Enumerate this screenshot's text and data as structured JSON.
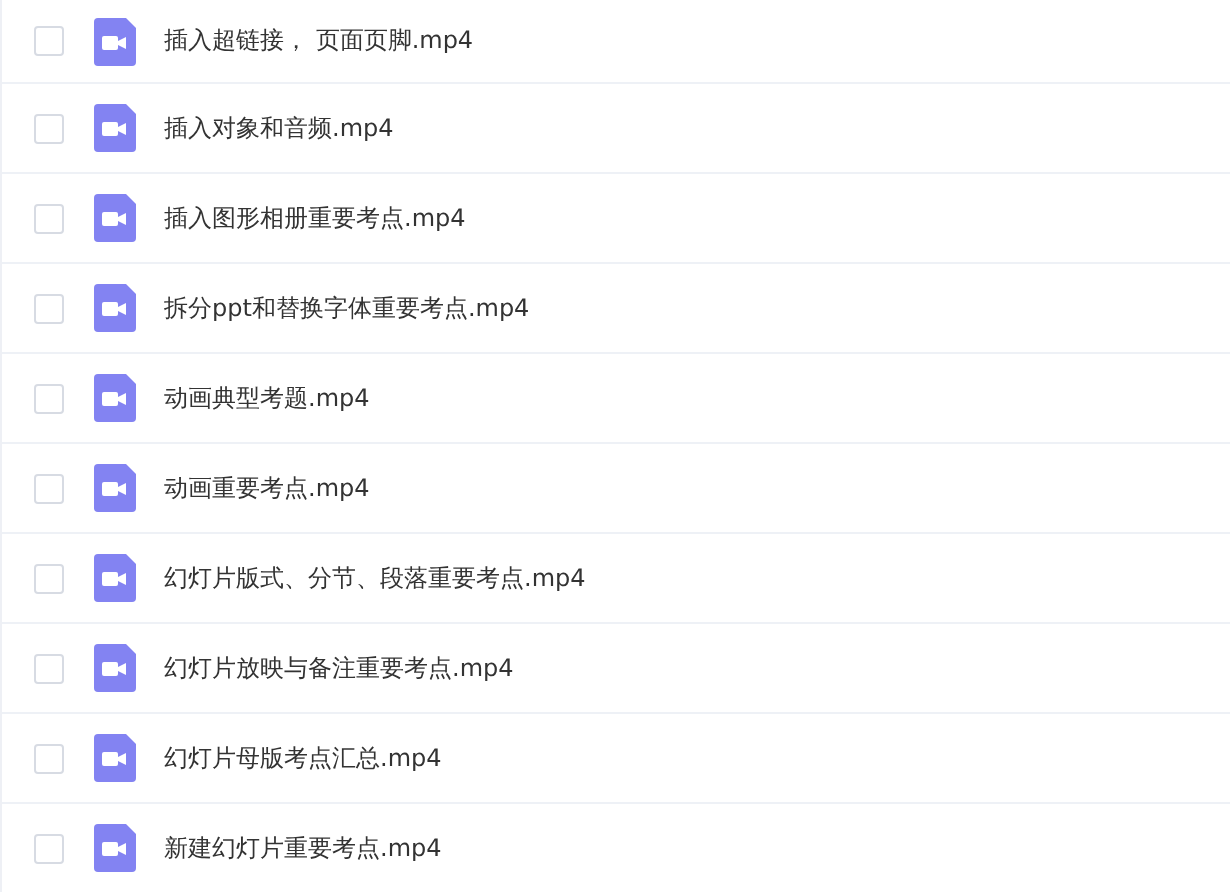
{
  "files": [
    {
      "name": "插入超链接， 页面页脚.mp4",
      "checked": false
    },
    {
      "name": "插入对象和音频.mp4",
      "checked": false
    },
    {
      "name": "插入图形相册重要考点.mp4",
      "checked": false
    },
    {
      "name": "拆分ppt和替换字体重要考点.mp4",
      "checked": false
    },
    {
      "name": "动画典型考题.mp4",
      "checked": false
    },
    {
      "name": "动画重要考点.mp4",
      "checked": false
    },
    {
      "name": "幻灯片版式、分节、段落重要考点.mp4",
      "checked": false
    },
    {
      "name": "幻灯片放映与备注重要考点.mp4",
      "checked": false
    },
    {
      "name": "幻灯片母版考点汇总.mp4",
      "checked": false
    },
    {
      "name": "新建幻灯片重要考点.mp4",
      "checked": false
    }
  ]
}
